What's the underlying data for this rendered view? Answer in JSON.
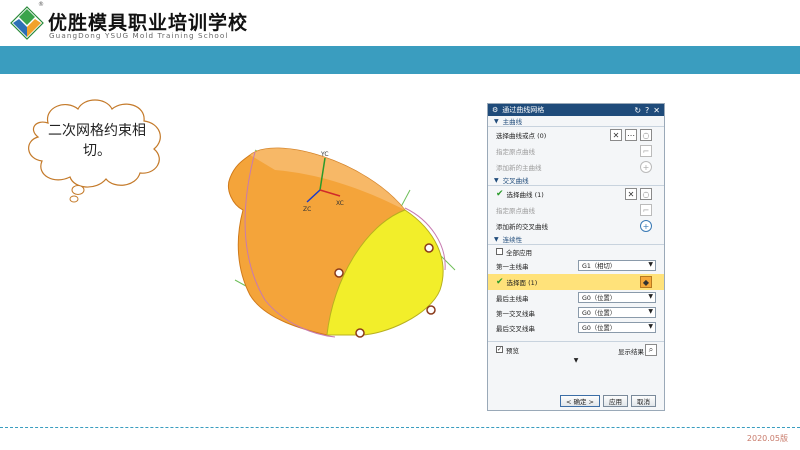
{
  "header": {
    "school_name_cn": "优胜模具职业培训学校",
    "school_name_en": "GuangDong YSUG Mold Training School",
    "registered_mark": "®",
    "band_color": "#3a9dbf"
  },
  "callout": {
    "text": "二次网格约束相切。"
  },
  "model": {
    "axis_labels": {
      "yc": "YC",
      "zc": "ZC",
      "xc": "XC"
    }
  },
  "dialog": {
    "title": "通过曲线网格",
    "title_icons": [
      "gear-icon",
      "reset-icon",
      "help-icon",
      "close-icon"
    ],
    "primary_curves": {
      "header": "主曲线",
      "select_label": "选择曲线或点 (0)",
      "specify_origin": "指定原点曲线",
      "add_new": "添加新的主曲线"
    },
    "cross_curves": {
      "header": "交叉曲线",
      "select_label": "选择曲线 (1)",
      "specify_origin": "指定原点曲线",
      "add_new": "添加新的交叉曲线"
    },
    "continuity": {
      "header": "连续性",
      "apply_all": "全部应用",
      "first_primary_label": "第一主线串",
      "first_primary_value": "G1（相切）",
      "select_face": "选择面 (1)",
      "last_primary_label": "最后主线串",
      "last_primary_value": "G0（位置）",
      "first_cross_label": "第一交叉线串",
      "first_cross_value": "G0（位置）",
      "last_cross_label": "最后交叉线串",
      "last_cross_value": "G0（位置）"
    },
    "preview_label": "预览",
    "show_result_label": "显示结果",
    "buttons": {
      "ok": "< 确定 >",
      "apply": "应用",
      "cancel": "取消"
    },
    "title_color": "#1f4b7a",
    "highlight_color": "#ffe27a"
  },
  "footer": {
    "version": "2020.05版"
  }
}
